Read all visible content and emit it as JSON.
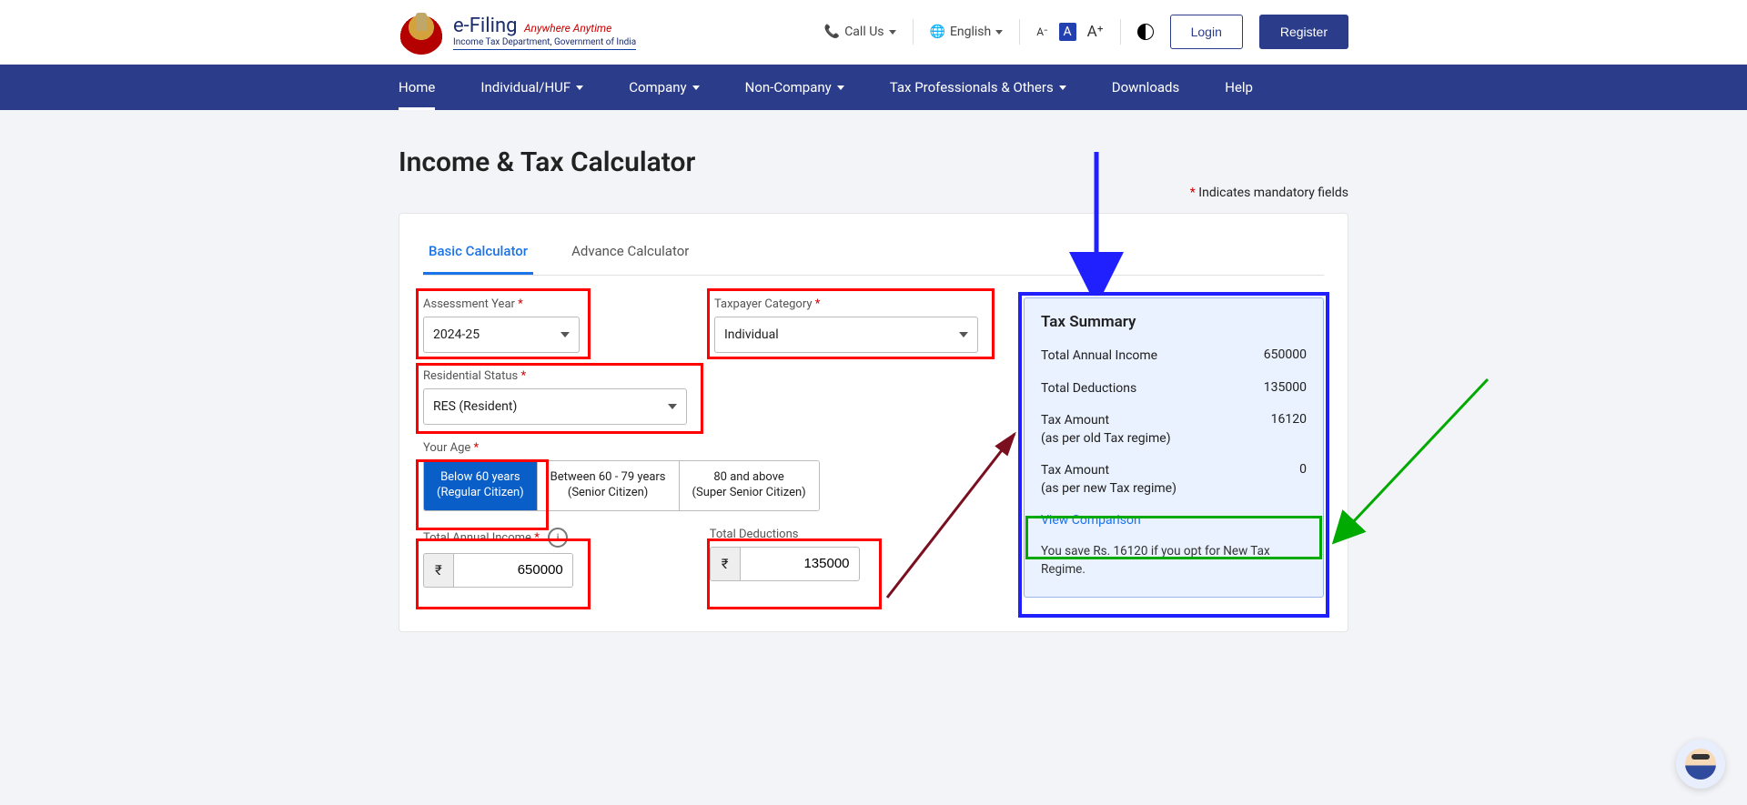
{
  "header": {
    "brand_title": "e-Filing",
    "brand_slogan": "Anywhere Anytime",
    "brand_sub": "Income Tax Department, Government of India",
    "call_us": "Call Us",
    "language": "English",
    "text_size_small": "A⁻",
    "text_size_mid": "A",
    "text_size_large": "A⁺",
    "login": "Login",
    "register": "Register"
  },
  "nav": {
    "home": "Home",
    "individual": "Individual/HUF",
    "company": "Company",
    "non_company": "Non-Company",
    "tax_prof": "Tax Professionals & Others",
    "downloads": "Downloads",
    "help": "Help"
  },
  "page": {
    "title": "Income & Tax Calculator",
    "mandatory": "Indicates mandatory fields",
    "tab_basic": "Basic Calculator",
    "tab_advance": "Advance Calculator"
  },
  "form": {
    "assessment_year_label": "Assessment Year",
    "assessment_year_value": "2024-25",
    "taxpayer_cat_label": "Taxpayer Category",
    "taxpayer_cat_value": "Individual",
    "residential_label": "Residential Status",
    "residential_value": "RES (Resident)",
    "age_label": "Your Age",
    "age_opt1_l1": "Below 60 years",
    "age_opt1_l2": "(Regular Citizen)",
    "age_opt2_l1": "Between 60 - 79 years",
    "age_opt2_l2": "(Senior Citizen)",
    "age_opt3_l1": "80 and above",
    "age_opt3_l2": "(Super Senior Citizen)",
    "income_label": "Total Annual Income",
    "income_value": "650000",
    "deductions_label": "Total Deductions",
    "deductions_value": "135000",
    "rupee": "₹"
  },
  "summary": {
    "title": "Tax Summary",
    "r1l": "Total Annual Income",
    "r1v": "650000",
    "r2l": "Total Deductions",
    "r2v": "135000",
    "r3l": "Tax Amount\n(as per old Tax regime)",
    "r3v": "16120",
    "r4l": "Tax Amount\n(as per new Tax regime)",
    "r4v": "0",
    "view_comp": "View Comparison",
    "save_note": "You save Rs. 16120 if you opt for New Tax Regime."
  }
}
